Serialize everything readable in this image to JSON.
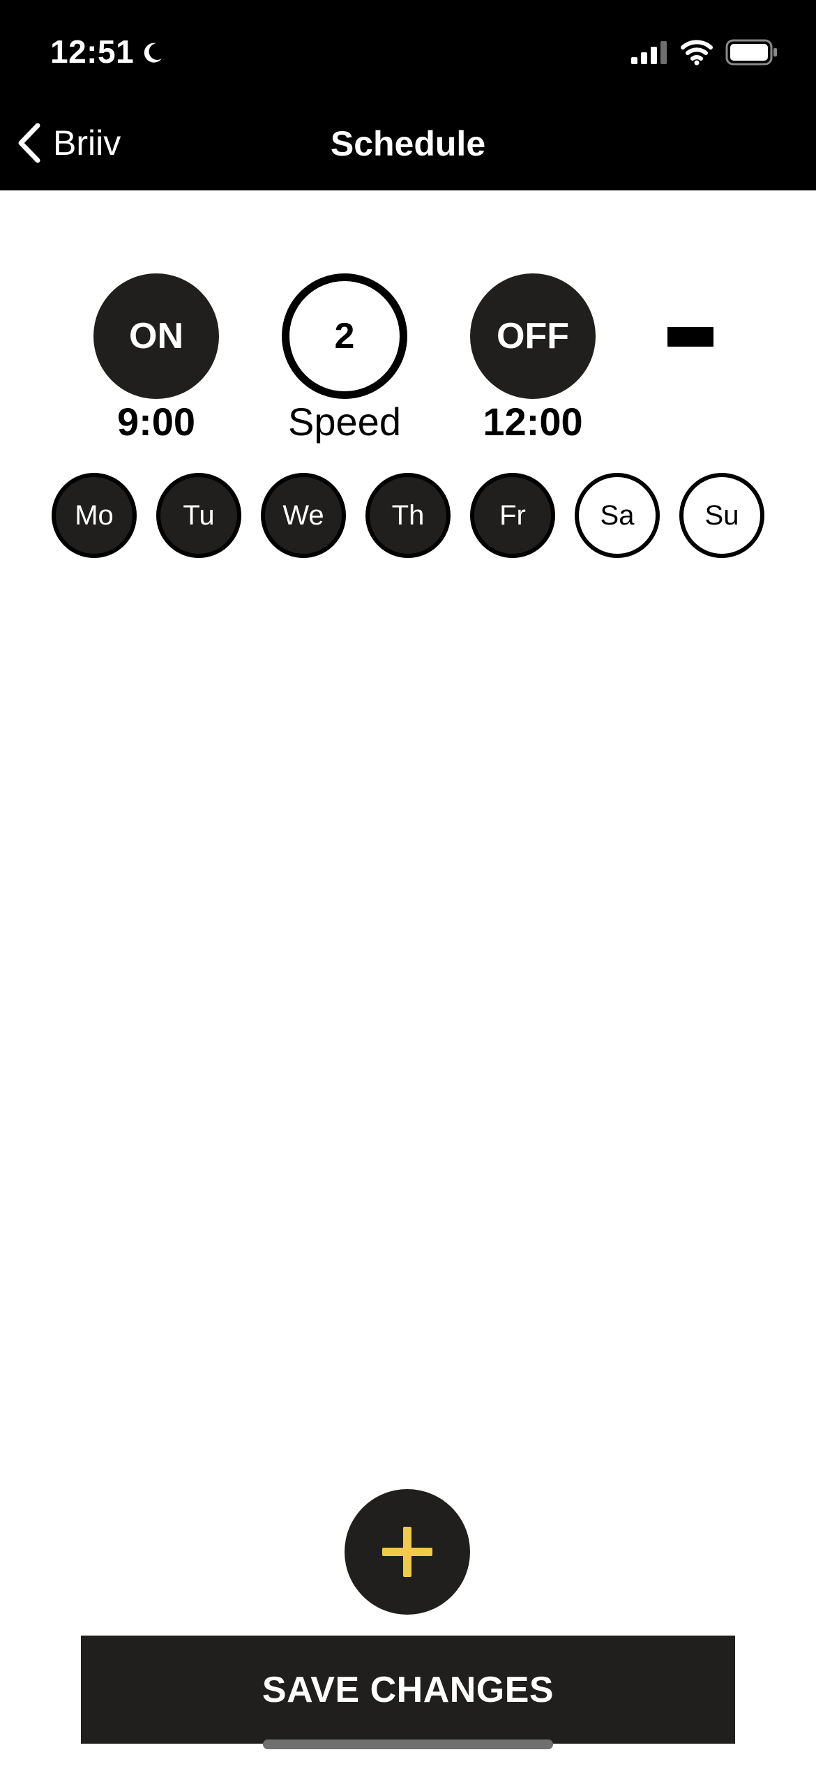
{
  "status_bar": {
    "time": "12:51",
    "icons": [
      "moon-icon",
      "cellular-signal-icon",
      "wifi-icon",
      "battery-icon"
    ]
  },
  "nav": {
    "back_label": "Briiv",
    "title": "Schedule"
  },
  "schedule": {
    "on_label": "ON",
    "on_time": "9:00",
    "speed_value": "2",
    "speed_label": "Speed",
    "off_label": "OFF",
    "off_time": "12:00",
    "days": [
      {
        "label": "Mo",
        "selected": true
      },
      {
        "label": "Tu",
        "selected": true
      },
      {
        "label": "We",
        "selected": true
      },
      {
        "label": "Th",
        "selected": true
      },
      {
        "label": "Fr",
        "selected": true
      },
      {
        "label": "Sa",
        "selected": false
      },
      {
        "label": "Su",
        "selected": false
      }
    ]
  },
  "actions": {
    "save_label": "SAVE CHANGES"
  },
  "colors": {
    "dark": "#201f1d",
    "header": "#000000",
    "accent_plus": "#f2c94c",
    "background": "#ffffff"
  }
}
